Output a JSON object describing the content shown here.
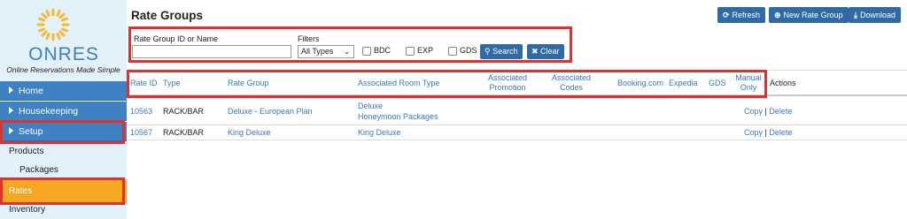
{
  "brand": {
    "logo_text": "ONRES",
    "tagline": "Online Reservations Made Simple"
  },
  "sidebar": {
    "items": [
      {
        "label": "Home",
        "type": "nav"
      },
      {
        "label": "Housekeeping",
        "type": "nav"
      },
      {
        "label": "Setup",
        "type": "nav"
      },
      {
        "label": "Products",
        "type": "sub"
      },
      {
        "label": "Packages",
        "type": "subsub"
      },
      {
        "label": "Rates",
        "type": "active"
      },
      {
        "label": "Inventory",
        "type": "sub"
      }
    ]
  },
  "header": {
    "title": "Rate Groups",
    "buttons": {
      "refresh": "Refresh",
      "new_rate_group": "New Rate Group",
      "download": "Download"
    }
  },
  "filters": {
    "search_label": "Rate Group ID or Name",
    "search_value": "",
    "filters_label": "Filters",
    "type_selected": "All Types",
    "checkboxes": [
      {
        "label": "BDC",
        "checked": false
      },
      {
        "label": "EXP",
        "checked": false
      },
      {
        "label": "GDS",
        "checked": false
      }
    ],
    "search_button": "Search",
    "clear_button": "Clear"
  },
  "table": {
    "headers": {
      "rate_id": "Rate ID",
      "type": "Type",
      "rate_group": "Rate Group",
      "room_type": "Associated Room Type",
      "promotion_1": "Associated",
      "promotion_2": "Promotion",
      "codes_1": "Associated",
      "codes_2": "Codes",
      "booking": "Booking.com",
      "expedia": "Expedia",
      "gds": "GDS",
      "manual_1": "Manual",
      "manual_2": "Only",
      "actions": "Actions"
    },
    "rows": [
      {
        "rate_id": "10563",
        "type": "RACK/BAR",
        "rate_group": "Deluxe - European Plan",
        "room_types": [
          "Deluxe",
          "Honeymoon Packages"
        ],
        "copy": "Copy",
        "sep": "|",
        "delete": "Delete"
      },
      {
        "rate_id": "10567",
        "type": "RACK/BAR",
        "rate_group": "King Deluxe",
        "room_types": [
          "King Deluxe"
        ],
        "copy": "Copy",
        "sep": "|",
        "delete": "Delete"
      }
    ]
  },
  "colors": {
    "nav_blue": "#3f82c4",
    "button_blue": "#2f6aa6",
    "accent_orange": "#f5a623",
    "highlight_red": "#e03030",
    "link_blue": "#3a78b8"
  }
}
